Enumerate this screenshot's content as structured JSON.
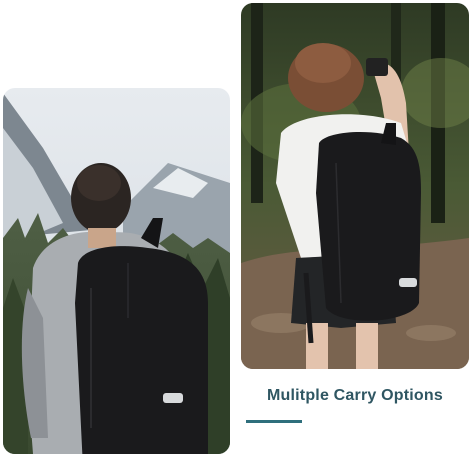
{
  "caption": {
    "text": "Mulitple Carry Options"
  },
  "colors": {
    "caption": "#2f5662",
    "accent_line": "#2f6f7c",
    "backpack": "#1a1a1c",
    "sky": "#dfe4ea"
  },
  "images": {
    "left": {
      "subject": "hiker with black backpack facing mountains"
    },
    "right": {
      "subject": "woman with black backpack on forest trail"
    }
  }
}
